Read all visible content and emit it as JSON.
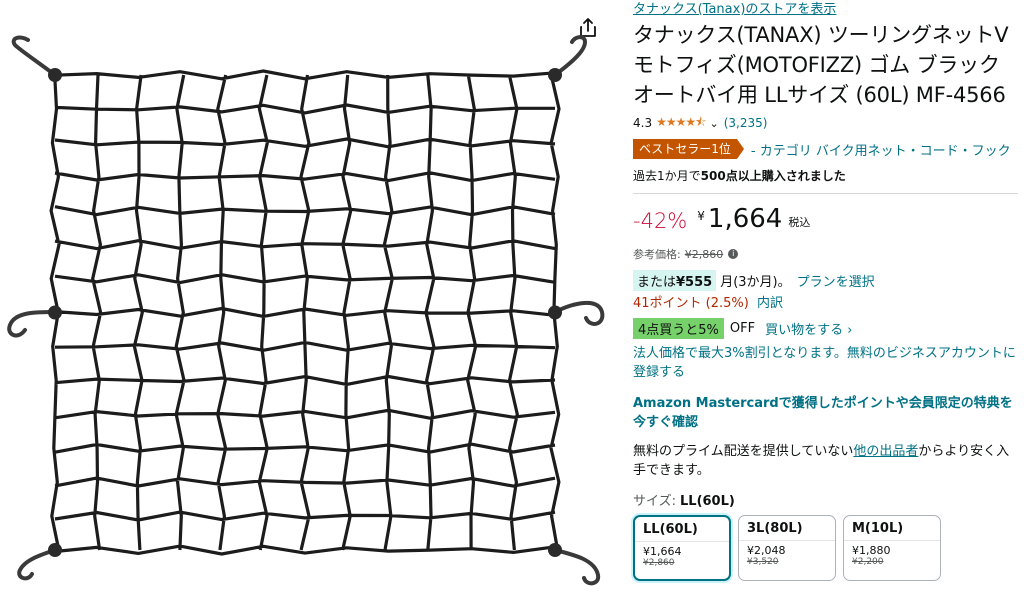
{
  "product": {
    "store_link": "タナックス(Tanax)のストアを表示",
    "title": "タナックス(TANAX) ツーリングネットV モトフィズ(MOTOFIZZ) ゴム ブラック オートバイ用 LLサイズ (60L) MF-4566",
    "rating_value": "4.3",
    "rating_stars": 4.3,
    "rating_count": "(3,235)",
    "bestseller_badge": "ベストセラー1位",
    "bestseller_category": "- カテゴリ バイク用ネット・コード・フック",
    "bought_prefix": "過去1か月で",
    "bought_bold": "500点以上購入されました"
  },
  "pricing": {
    "discount": "-42%",
    "currency": "¥",
    "price": "1,664",
    "tax": "税込",
    "ref_label": "参考価格:",
    "ref_price": "¥2,860",
    "installment_prefix": "または",
    "installment_amount": "¥555",
    "installment_suffix": "月(3か月)。",
    "plan_link": "プランを選択",
    "points": "41ポイント (2.5%)",
    "points_breakdown": "内訳",
    "promo_badge": "4点買うと5%",
    "promo_off": "OFF",
    "promo_link": "買い物をする ›"
  },
  "business": {
    "text": "法人価格で最大3%割引となります。無料のビジネスアカウントに登録する"
  },
  "mastercard": {
    "text": "Amazon Mastercardで獲得したポイントや会員限定の特典を今すぐ確認"
  },
  "prime": {
    "prefix": "無料のプライム配送を提供していない",
    "link": "他の出品者",
    "suffix": "からより安く入手できます。"
  },
  "size": {
    "label": "サイズ:",
    "selected": "LL(60L)",
    "options": [
      {
        "name": "LL(60L)",
        "price": "¥1,664",
        "ref": "¥2,860"
      },
      {
        "name": "3L(80L)",
        "price": "¥2,048",
        "ref": "¥3,520"
      },
      {
        "name": "M(10L)",
        "price": "¥1,880",
        "ref": "¥2,200"
      }
    ]
  },
  "colors": {
    "link": "#007185",
    "discount": "#cc0c39",
    "badge": "#c45500",
    "stars": "#de7921",
    "promo": "#77d16b"
  },
  "icons": {
    "share": "share-icon",
    "info": "info-icon",
    "chevron": "chevron-down-icon"
  }
}
